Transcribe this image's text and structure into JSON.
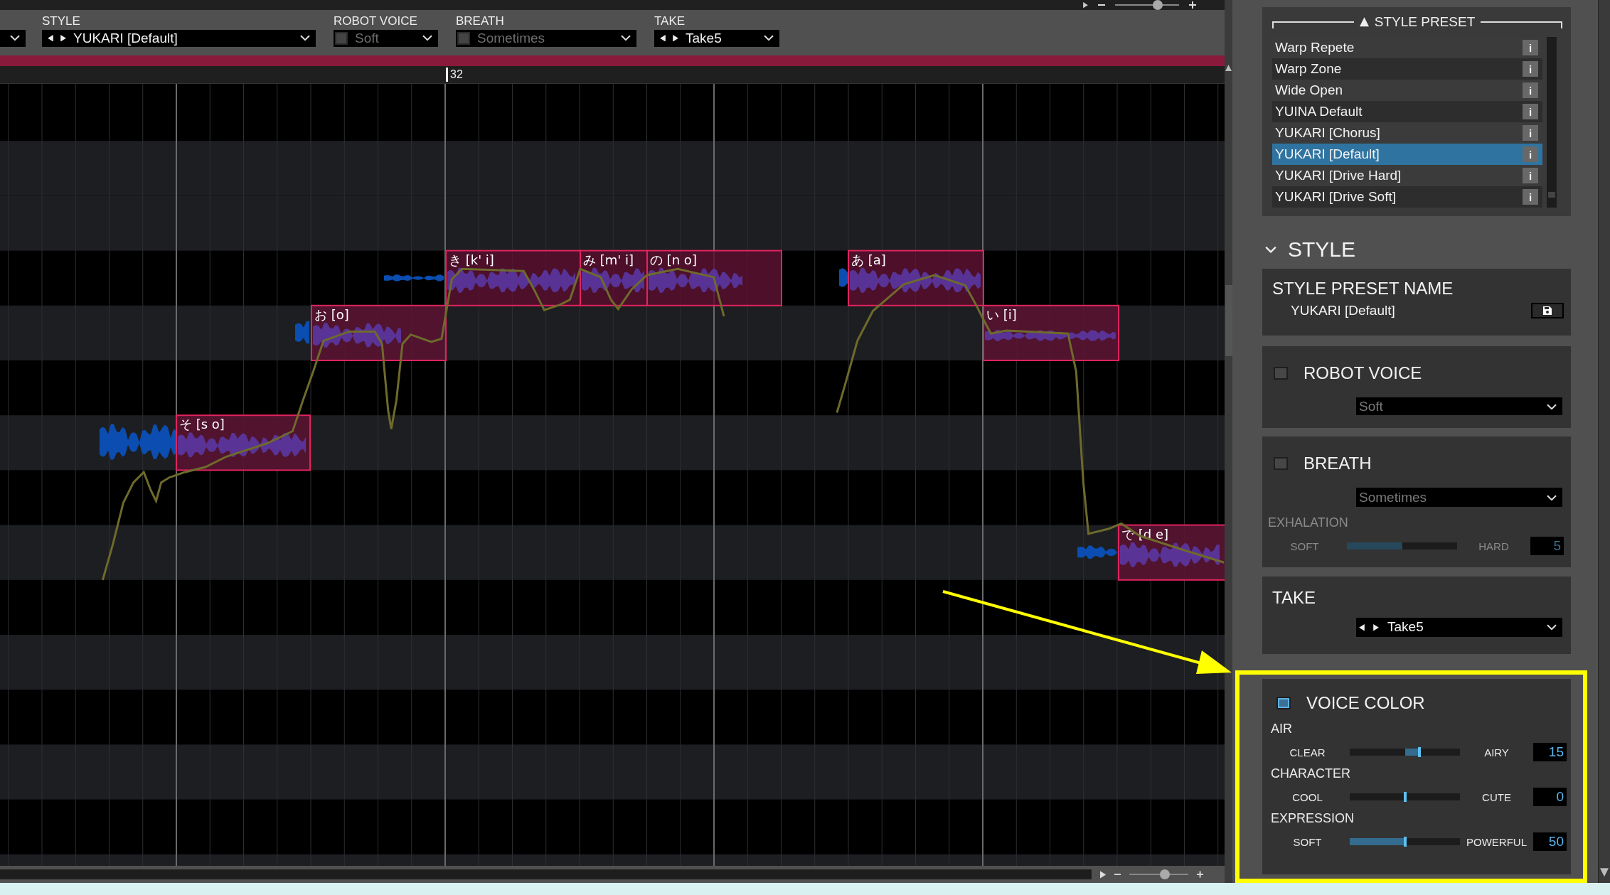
{
  "toolbar": {
    "fields": [
      {
        "kind": "stepper",
        "label": "STYLE",
        "value": "YUKARI [Default]"
      },
      {
        "kind": "toggle",
        "label": "ROBOT VOICE",
        "checked": false,
        "value": "Soft"
      },
      {
        "kind": "toggle",
        "label": "BREATH",
        "checked": false,
        "value": "Sometimes"
      },
      {
        "kind": "stepper",
        "label": "TAKE",
        "value": "Take5"
      }
    ]
  },
  "top_zoom": {
    "level": 0.67
  },
  "ruler": {
    "marker": "32"
  },
  "bottom_zoom": {
    "level": 0.6
  },
  "notes": [
    {
      "lyric": "そ [s o]"
    },
    {
      "lyric": "お [o]"
    },
    {
      "lyric": "き [k' i]"
    },
    {
      "lyric": "み [m' i]"
    },
    {
      "lyric": "の [n o]"
    },
    {
      "lyric": "あ [a]"
    },
    {
      "lyric": "い [i]"
    },
    {
      "lyric": "で [d e]"
    }
  ],
  "style_preset": {
    "title": "STYLE PRESET",
    "items": [
      {
        "name": "Warp Repete",
        "info": "i",
        "selected": false
      },
      {
        "name": "Warp Zone",
        "info": "i",
        "selected": false
      },
      {
        "name": "Wide Open",
        "info": "i",
        "selected": false
      },
      {
        "name": "YUINA Default",
        "info": "i",
        "selected": false
      },
      {
        "name": "YUKARI [Chorus]",
        "info": "i",
        "selected": false
      },
      {
        "name": "YUKARI [Default]",
        "info": "i",
        "selected": true
      },
      {
        "name": "YUKARI [Drive Hard]",
        "info": "i",
        "selected": false
      },
      {
        "name": "YUKARI [Drive Soft]",
        "info": "i",
        "selected": false
      }
    ]
  },
  "style": {
    "title": "STYLE",
    "expanded": true,
    "preset_name": {
      "title": "STYLE PRESET NAME",
      "value": "YUKARI [Default]"
    },
    "robot_voice": {
      "title": "ROBOT VOICE",
      "checked": false,
      "value": "Soft"
    },
    "breath": {
      "title": "BREATH",
      "checked": false,
      "value": "Sometimes",
      "exhalation": {
        "title": "EXHALATION",
        "left": "SOFT",
        "right": "HARD",
        "kind": "unipolar",
        "level": 0.5,
        "value": "5"
      }
    },
    "take": {
      "title": "TAKE",
      "value": "Take5"
    },
    "voice_color": {
      "title": "VOICE COLOR",
      "checked": true,
      "sliders": [
        {
          "title": "AIR",
          "left": "CLEAR",
          "right": "AIRY",
          "kind": "bipolar",
          "level": 0.63,
          "value": "15"
        },
        {
          "title": "CHARACTER",
          "left": "COOL",
          "right": "CUTE",
          "kind": "bipolar",
          "level": 0.5,
          "value": "0"
        },
        {
          "title": "EXPRESSION",
          "left": "SOFT",
          "right": "POWERFUL",
          "kind": "unipolar",
          "level": 0.5,
          "value": "50"
        }
      ]
    }
  }
}
